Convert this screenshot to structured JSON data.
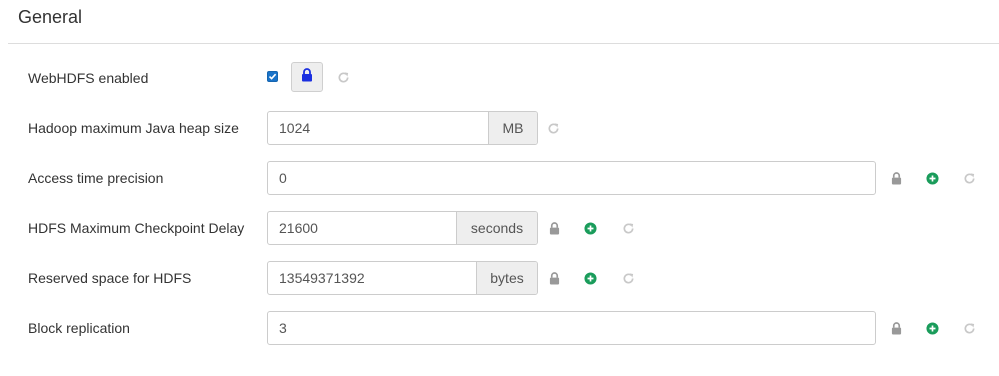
{
  "section": {
    "title": "General"
  },
  "rows": [
    {
      "label": "WebHDFS enabled",
      "checked": true
    },
    {
      "label": "Hadoop maximum Java heap size",
      "value": "1024",
      "unit": "MB"
    },
    {
      "label": "Access time precision",
      "value": "0"
    },
    {
      "label": "HDFS Maximum Checkpoint Delay",
      "value": "21600",
      "unit": "seconds"
    },
    {
      "label": "Reserved space for HDFS",
      "value": "13549371392",
      "unit": "bytes"
    },
    {
      "label": "Block replication",
      "value": "3"
    }
  ],
  "icons": {
    "lock": "lock-icon",
    "add_override": "plus-circle-icon",
    "undo": "refresh-icon"
  },
  "colors": {
    "checkbox": "#1a73c9",
    "lock_active": "#1a2fe0",
    "lock_gray": "#999999",
    "add_green": "#1a9c5b",
    "undo_gray": "#c8c8c8"
  }
}
